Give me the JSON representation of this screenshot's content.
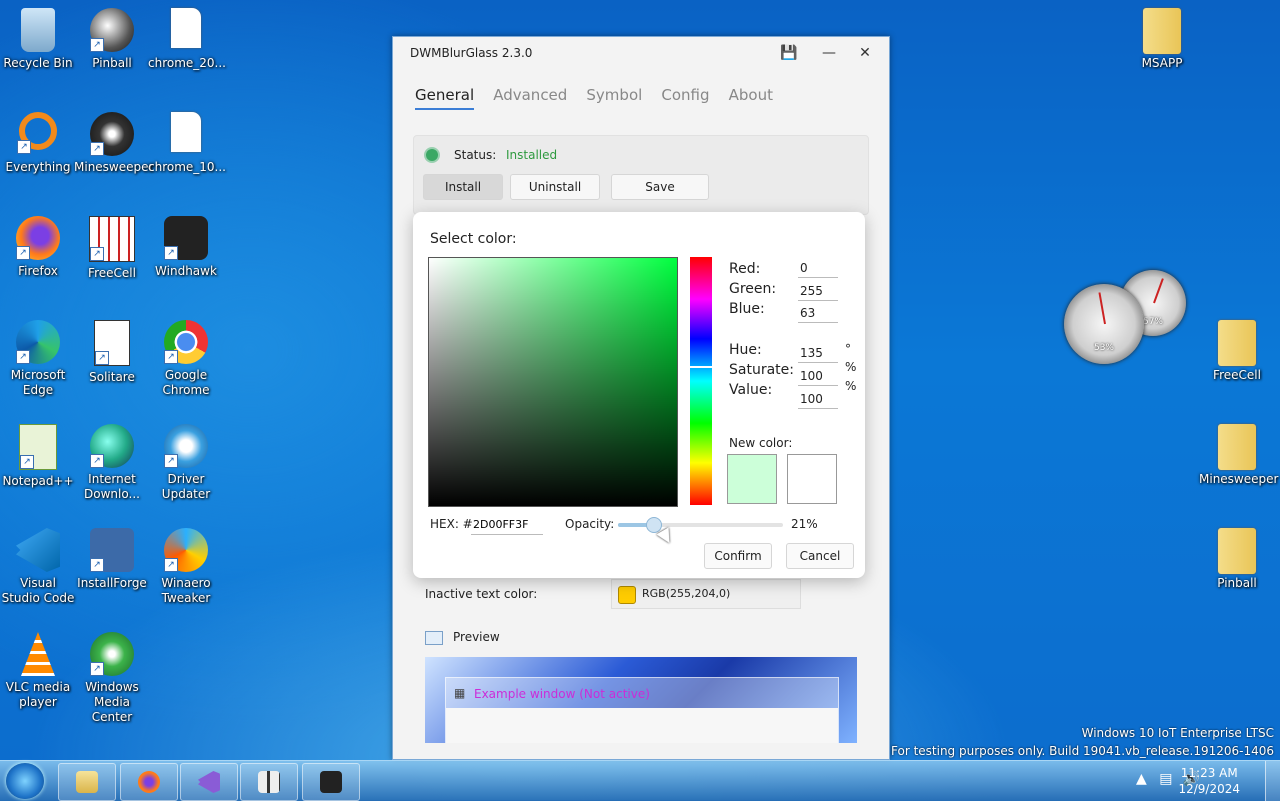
{
  "desktop_icons": [
    {
      "label": "Recycle Bin"
    },
    {
      "label": "Pinball"
    },
    {
      "label": "chrome_20..."
    },
    {
      "label": "Everything"
    },
    {
      "label": "Minesweeper"
    },
    {
      "label": "chrome_10..."
    },
    {
      "label": "Firefox"
    },
    {
      "label": "FreeCell"
    },
    {
      "label": "Windhawk"
    },
    {
      "label": "Microsoft Edge"
    },
    {
      "label": "Solitare"
    },
    {
      "label": "Google Chrome"
    },
    {
      "label": "Notepad++"
    },
    {
      "label": "Internet Downlo..."
    },
    {
      "label": "Driver Updater"
    },
    {
      "label": "Visual Studio Code"
    },
    {
      "label": "InstallForge"
    },
    {
      "label": "Winaero Tweaker"
    },
    {
      "label": "VLC media player"
    },
    {
      "label": "Windows Media Center"
    }
  ],
  "right_icons": [
    {
      "label": "MSAPP"
    },
    {
      "label": "FreeCell"
    },
    {
      "label": "Minesweeper"
    },
    {
      "label": "Pinball"
    }
  ],
  "gadgets": {
    "gauge1": "53%",
    "gauge2": "57%"
  },
  "window": {
    "title": "DWMBlurGlass 2.3.0",
    "tabs": [
      "General",
      "Advanced",
      "Symbol",
      "Config",
      "About"
    ],
    "status_label": "Status:",
    "status_value": "Installed",
    "buttons": {
      "install": "Install",
      "uninstall": "Uninstall",
      "save": "Save"
    },
    "inactive_text_label": "Inactive text color:",
    "inactive_text_value": "RGB(255,204,0)",
    "inactive_text_color": "#ffcc00",
    "preview_label": "Preview",
    "preview_window_title": "Example window (Not active)"
  },
  "color_dialog": {
    "title": "Select color:",
    "red_label": "Red:",
    "red": "0",
    "green_label": "Green:",
    "green": "255",
    "blue_label": "Blue:",
    "blue": "63",
    "hue_label": "Hue:",
    "hue": "135",
    "hue_unit": "°",
    "saturate_label": "Saturate:",
    "saturate": "100",
    "saturate_unit": "%",
    "value_label": "Value:",
    "value": "100",
    "value_unit": "%",
    "new_color_label": "New color:",
    "new_color": "#ccffd9",
    "old_color": "#ffffff",
    "hex_label": "HEX: #",
    "hex": "2D00FF3F",
    "opacity_label": "Opacity:",
    "opacity": "21%",
    "opacity_fraction": 0.21,
    "confirm": "Confirm",
    "cancel": "Cancel"
  },
  "watermark": {
    "line1": "Windows 10 IoT Enterprise LTSC",
    "line2": "For testing purposes only. Build 19041.vb_release.191206-1406"
  },
  "taskbar": {
    "time": "11:23 AM",
    "date": "12/9/2024"
  }
}
